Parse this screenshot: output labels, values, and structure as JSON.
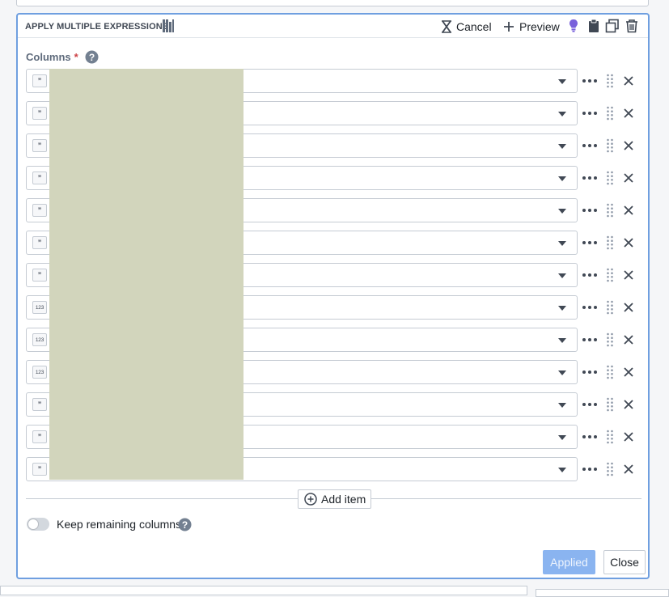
{
  "header": {
    "title": "APPLY MULTIPLE EXPRESSIONS",
    "cancel_label": "Cancel",
    "preview_label": "Preview",
    "icons": [
      "book-icon",
      "cancel-icon",
      "plus-icon",
      "lightbulb-icon",
      "clipboard-icon",
      "duplicate-icon",
      "trash-icon"
    ]
  },
  "columns_field": {
    "label": "Columns",
    "required_mark": "*"
  },
  "rows": [
    {
      "type": "string",
      "badge": "”"
    },
    {
      "type": "string",
      "badge": "”"
    },
    {
      "type": "string",
      "badge": "”"
    },
    {
      "type": "string",
      "badge": "”"
    },
    {
      "type": "string",
      "badge": "”"
    },
    {
      "type": "string",
      "badge": "”"
    },
    {
      "type": "string",
      "badge": "”"
    },
    {
      "type": "number",
      "badge": "123"
    },
    {
      "type": "number",
      "badge": "123"
    },
    {
      "type": "number",
      "badge": "123"
    },
    {
      "type": "string",
      "badge": "”"
    },
    {
      "type": "string",
      "badge": "”"
    },
    {
      "type": "string",
      "badge": "”"
    }
  ],
  "add_item_label": "Add item",
  "keep_remaining": {
    "label": "Keep remaining columns",
    "checked": false
  },
  "footer": {
    "applied_label": "Applied",
    "close_label": "Close"
  },
  "colors": {
    "accent_border": "#6f9fe0",
    "applied_button": "#8ab4f0",
    "lightbulb": "#7961db",
    "required": "#cd4246",
    "redaction": "#d2d5bc"
  }
}
